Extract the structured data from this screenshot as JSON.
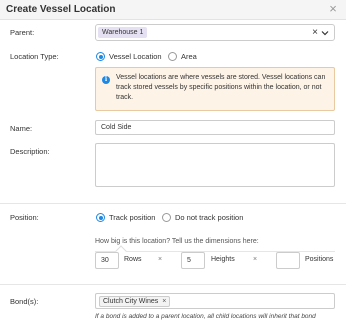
{
  "dialog": {
    "title": "Create Vessel Location",
    "close_icon": "×"
  },
  "parent": {
    "label": "Parent:",
    "selected": "Warehouse 1",
    "clear_icon": "×"
  },
  "location_type": {
    "label": "Location Type:",
    "options": [
      "Vessel Location",
      "Area"
    ],
    "selected": "Vessel Location"
  },
  "info": {
    "icon": "i",
    "text": "Vessel locations are where vessels are stored. Vessel locations can track stored vessels by specific positions within the location, or not track."
  },
  "name": {
    "label": "Name:",
    "value": "Cold Side"
  },
  "description": {
    "label": "Description:",
    "value": ""
  },
  "position": {
    "label": "Position:",
    "options": [
      "Track position",
      "Do not track position"
    ],
    "selected": "Track position",
    "hint": "How big is this location? Tell us the dimensions here:",
    "rows_value": "30",
    "rows_label": "Rows",
    "times1": "×",
    "heights_value": "5",
    "heights_label": "Heights",
    "times2": "×",
    "positions_value": "",
    "positions_label": "Positions"
  },
  "bonds": {
    "label": "Bond(s):",
    "tags": [
      {
        "label": "Clutch City Wines",
        "remove": "×"
      }
    ],
    "note": "If a bond is added to a parent location, all child locations will inherit that bond"
  },
  "colors": {
    "accent": "#1e88e5",
    "info_bg": "#fdf3e7",
    "chip_bg": "#e6e1f2"
  }
}
